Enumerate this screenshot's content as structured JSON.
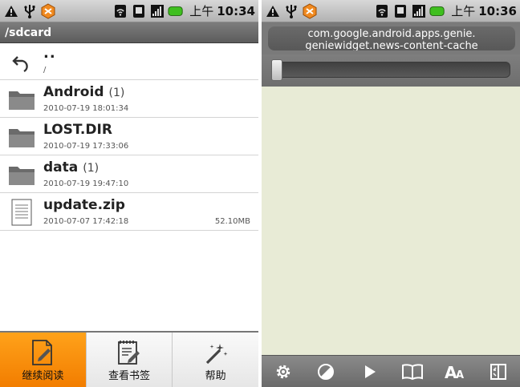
{
  "status_left": {
    "time_prefix": "上午",
    "time": "10:34"
  },
  "status_right": {
    "time_prefix": "上午",
    "time": "10:36"
  },
  "file_browser": {
    "path_title": "/sdcard",
    "entries": [
      {
        "name": "..",
        "date": "/",
        "kind": "parent",
        "icon": "up-arrow-icon"
      },
      {
        "name": "Android",
        "count": "(1)",
        "date": "2010-07-19 18:01:34",
        "kind": "folder",
        "icon": "folder-icon"
      },
      {
        "name": "LOST.DIR",
        "date": "2010-07-19 17:33:06",
        "kind": "folder",
        "icon": "folder-icon"
      },
      {
        "name": "data",
        "count": "(1)",
        "date": "2010-07-19 19:47:10",
        "kind": "folder",
        "icon": "folder-icon"
      },
      {
        "name": "update.zip",
        "date": "2010-07-07 17:42:18",
        "size": "52.10MB",
        "kind": "file",
        "icon": "file-icon"
      }
    ],
    "menu": [
      {
        "label": "继续阅读",
        "icon": "continue-reading-icon",
        "active": true
      },
      {
        "label": "查看书签",
        "icon": "bookmarks-icon",
        "active": false
      },
      {
        "label": "帮助",
        "icon": "magic-wand-icon",
        "active": false
      }
    ]
  },
  "reader": {
    "url_line1": "com.google.android.apps.genie.",
    "url_line2": "geniewidget.news-content-cache",
    "progress": 0.0,
    "toolbar": [
      "settings-gear-icon",
      "contrast-icon",
      "play-icon",
      "book-icon",
      "font-size-icon",
      "layout-icon"
    ],
    "toolbar_font_label": "A"
  },
  "colors": {
    "accent_active": "#f58a0a",
    "reader_background": "#e8ebd6",
    "title_bar": "#6a6a6a"
  }
}
